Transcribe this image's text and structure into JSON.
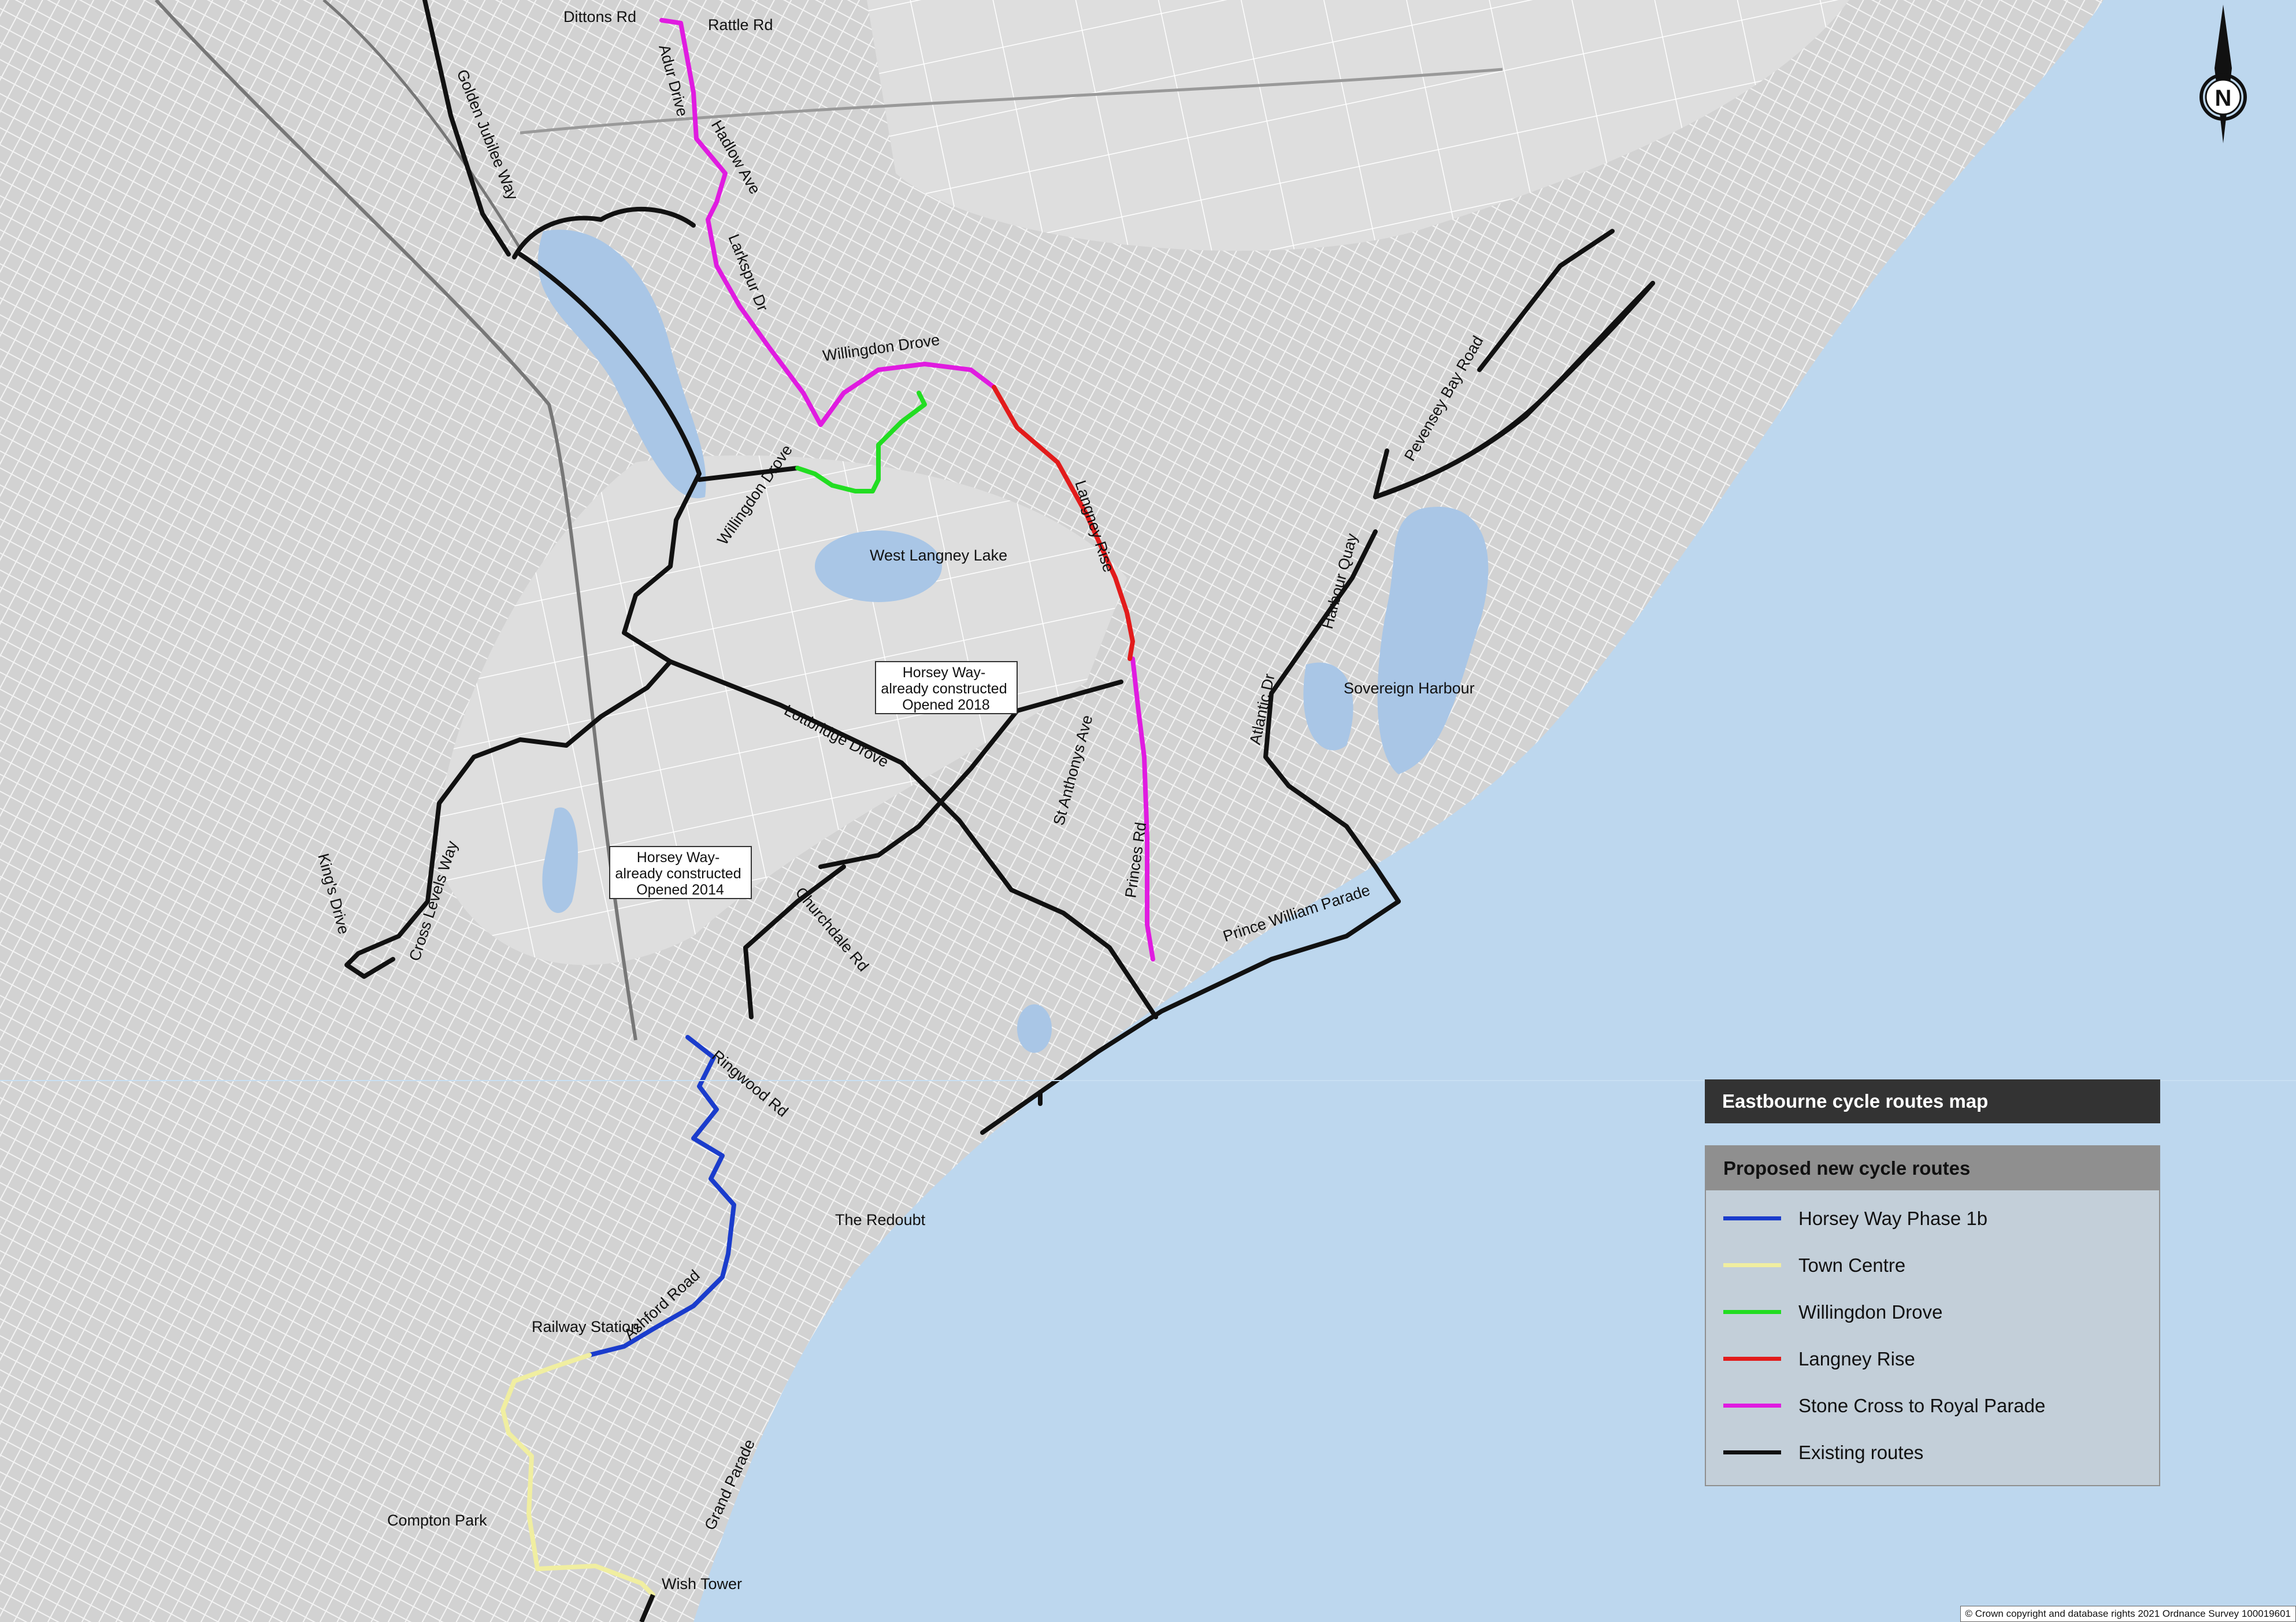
{
  "legend": {
    "title": "Eastbourne cycle routes map",
    "header": "Proposed new cycle routes",
    "items": [
      {
        "label": "Horsey Way Phase 1b",
        "color": "#1a3ccc"
      },
      {
        "label": "Town Centre",
        "color": "#f0eea0"
      },
      {
        "label": "Willingdon Drove",
        "color": "#22dd22"
      },
      {
        "label": "Langney Rise",
        "color": "#e21b1b"
      },
      {
        "label": "Stone Cross to Royal Parade",
        "color": "#e01be0"
      },
      {
        "label": "Existing routes",
        "color": "#111111"
      }
    ]
  },
  "colors": {
    "sea": "#bdd7ee",
    "land": "#d4d4d4",
    "lake": "#a9c6e6",
    "road_lines": "#ffffff",
    "existing_route": "#111111"
  },
  "street_labels": {
    "dittons_rd": "Dittons Rd",
    "rattle_rd": "Rattle Rd",
    "adur_drive": "Adur Drive",
    "hadlow_ave": "Hadlow Ave",
    "larkspur_dr": "Larkspur Dr",
    "willingdon_drove_top": "Willingdon Drove",
    "willingdon_drove_rot": "Willingdon Drove",
    "golden_jubilee_way": "Golden Jubilee Way",
    "langney_rise": "Langney Rise",
    "pevensey_bay_road": "Pevensey Bay Road",
    "harbour_quay": "Harbour Quay",
    "atlantic_dr": "Atlantic Dr",
    "lottbridge_drove": "Lottbridge Drove",
    "st_anthonys_ave": "St Anthonys Ave",
    "princes_rd": "Princes Rd",
    "prince_william_parade": "Prince William Parade",
    "churchdale_rd": "Churchdale Rd",
    "kings_drive": "King's Drive",
    "cross_levels_way": "Cross Levels Way",
    "ringwood_rd": "Ringwood Rd",
    "ashford_road": "Ashford Road",
    "grand_parade": "Grand Parade"
  },
  "place_labels": {
    "west_langney_lake": "West Langney Lake",
    "sovereign_harbour": "Sovereign Harbour",
    "the_redoubt": "The Redoubt",
    "railway_station": "Railway Station",
    "compton_park": "Compton Park",
    "wish_tower": "Wish Tower"
  },
  "callouts": {
    "horsey_2018": [
      "Horsey Way-",
      "already constructed",
      "Opened 2018"
    ],
    "horsey_2014": [
      "Horsey Way-",
      "already constructed",
      "Opened 2014"
    ]
  },
  "north_label": "N",
  "copyright": "© Crown copyright and database rights 2021 Ordnance Survey 100019601"
}
